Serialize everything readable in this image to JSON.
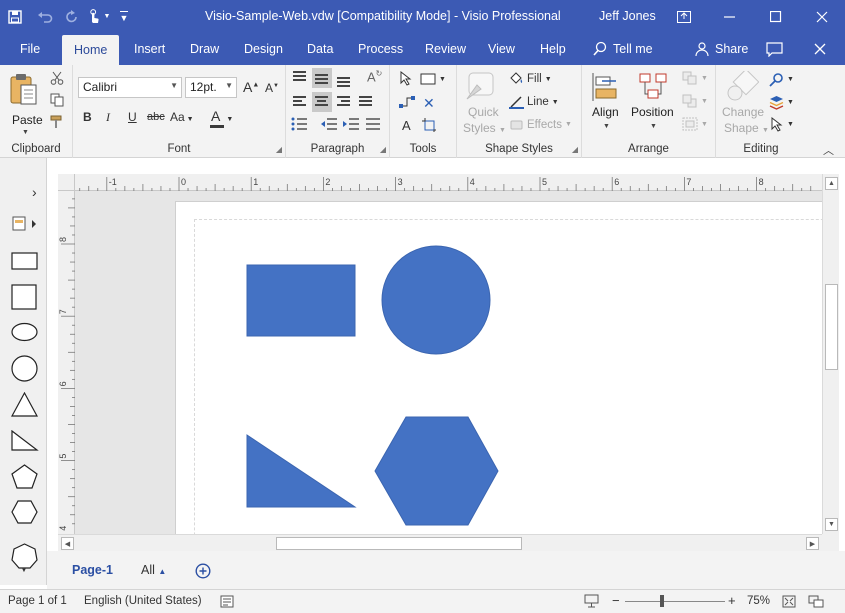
{
  "titlebar": {
    "title": "Visio-Sample-Web.vdw  [Compatibility Mode]  -  Visio Professional",
    "user": "Jeff Jones",
    "qat_icons": [
      "save-icon",
      "undo-icon",
      "redo-icon",
      "touch-mode-icon",
      "customize-qat-icon"
    ],
    "window_buttons": [
      "ribbon-display-icon",
      "minimize-icon",
      "maximize-icon",
      "close-icon"
    ]
  },
  "tabs": {
    "items": [
      "File",
      "Home",
      "Insert",
      "Draw",
      "Design",
      "Data",
      "Process",
      "Review",
      "View",
      "Help"
    ],
    "active": "Home",
    "tell_me": "Tell me",
    "share": "Share"
  },
  "ribbon": {
    "clipboard": {
      "label": "Clipboard",
      "paste": "Paste"
    },
    "font": {
      "label": "Font",
      "font_name": "Calibri",
      "font_size": "12pt.",
      "bold": "B",
      "italic": "I",
      "underline": "U",
      "strike": "abc",
      "case": "Aa",
      "color": "A"
    },
    "paragraph": {
      "label": "Paragraph"
    },
    "tools": {
      "label": "Tools",
      "text_tool": "A"
    },
    "shape_styles": {
      "label": "Shape Styles",
      "quick_styles_line1": "Quick",
      "quick_styles_line2": "Styles",
      "fill": "Fill",
      "line": "Line",
      "effects": "Effects"
    },
    "arrange": {
      "label": "Arrange",
      "align": "Align",
      "position": "Position"
    },
    "editing": {
      "label": "Editing",
      "change_shape_line1": "Change",
      "change_shape_line2": "Shape"
    }
  },
  "rulers": {
    "horizontal_labels": [
      "-1",
      "0",
      "1",
      "2",
      "3",
      "4",
      "5",
      "6",
      "7",
      "8"
    ],
    "vertical_labels": [
      "8",
      "7",
      "6",
      "5",
      "4"
    ]
  },
  "canvas": {
    "shape_fill": "#4472c4",
    "shape_stroke": "#3b65b0",
    "shapes": [
      "rectangle",
      "circle",
      "right-triangle",
      "hexagon"
    ]
  },
  "page_tabs": {
    "current": "Page-1",
    "all": "All"
  },
  "status": {
    "page": "Page 1 of 1",
    "language": "English (United States)",
    "zoom": "75%",
    "zoom_minus": "−",
    "zoom_plus": "+"
  }
}
